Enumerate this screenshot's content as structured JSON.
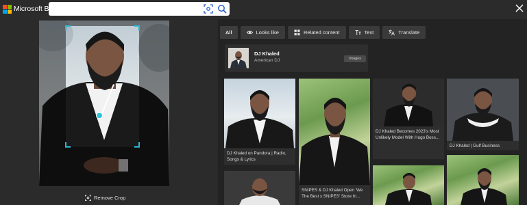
{
  "header": {
    "brand": "Microsoft Bing",
    "search_value": "",
    "logo_colors": [
      "#f25022",
      "#7fba00",
      "#00a4ef",
      "#ffb900"
    ]
  },
  "left": {
    "remove_crop_label": "Remove Crop"
  },
  "tabs": [
    {
      "label": "All",
      "icon": "none",
      "active": true
    },
    {
      "label": "Looks like",
      "icon": "eye-icon",
      "active": false
    },
    {
      "label": "Related content",
      "icon": "grid-icon",
      "active": false
    },
    {
      "label": "Text",
      "icon": "text-icon",
      "active": false
    },
    {
      "label": "Translate",
      "icon": "translate-icon",
      "active": false
    }
  ],
  "entity": {
    "name": "DJ Khaled",
    "description": "American DJ",
    "badge": "Images"
  },
  "results": [
    {
      "caption": "DJ Khaled on Pandora | Radio, Songs & Lyrics"
    },
    {
      "caption": "SNIPES & DJ Khaled Open 'We The Best x SNIPES' Store In..."
    },
    {
      "caption": "DJ Khaled Becomes 2023's Most Unlikely Model With Hugo Boss..."
    },
    {
      "caption": "DJ Khaled | Gulf Business"
    },
    {
      "caption": ""
    },
    {
      "caption": ""
    },
    {
      "caption": ""
    }
  ],
  "colors": {
    "accent_crop": "#29b6d1",
    "background": "#2b2b2b",
    "panel": "#232323"
  }
}
